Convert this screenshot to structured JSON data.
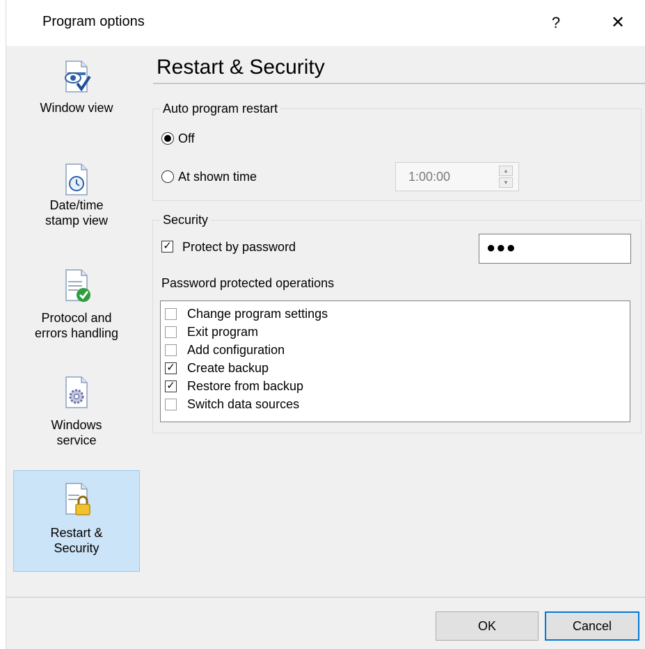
{
  "window": {
    "title": "Program options",
    "help_glyph": "?",
    "close_glyph": "✕"
  },
  "sidebar": {
    "items": [
      {
        "label": "Window view",
        "icon": "window-view-icon"
      },
      {
        "label": "Date/time\nstamp view",
        "icon": "clock-icon"
      },
      {
        "label": "Protocol and\nerrors handling",
        "icon": "checkmark-document-icon"
      },
      {
        "label": "Windows\nservice",
        "icon": "gear-icon"
      },
      {
        "label": "Restart &\nSecurity",
        "icon": "lock-icon",
        "selected": true
      }
    ]
  },
  "page": {
    "title": "Restart & Security"
  },
  "restart": {
    "group_label": "Auto program restart",
    "off_label": "Off",
    "at_time_label": "At shown time",
    "time_value": "1:00:00",
    "selected": "off"
  },
  "security": {
    "group_label": "Security",
    "protect_label": "Protect by password",
    "protect_checked": true,
    "password_mask": "●●●",
    "ops_label": "Password protected operations",
    "operations": [
      {
        "label": "Change program settings",
        "checked": false
      },
      {
        "label": "Exit program",
        "checked": false
      },
      {
        "label": "Add configuration",
        "checked": false
      },
      {
        "label": "Create backup",
        "checked": true
      },
      {
        "label": "Restore from backup",
        "checked": true
      },
      {
        "label": "Switch data sources",
        "checked": false
      }
    ]
  },
  "buttons": {
    "ok": "OK",
    "cancel": "Cancel"
  },
  "colors": {
    "selected_bg": "#cce4f7",
    "selected_border": "#99c9ef",
    "accent": "#0078d7"
  }
}
